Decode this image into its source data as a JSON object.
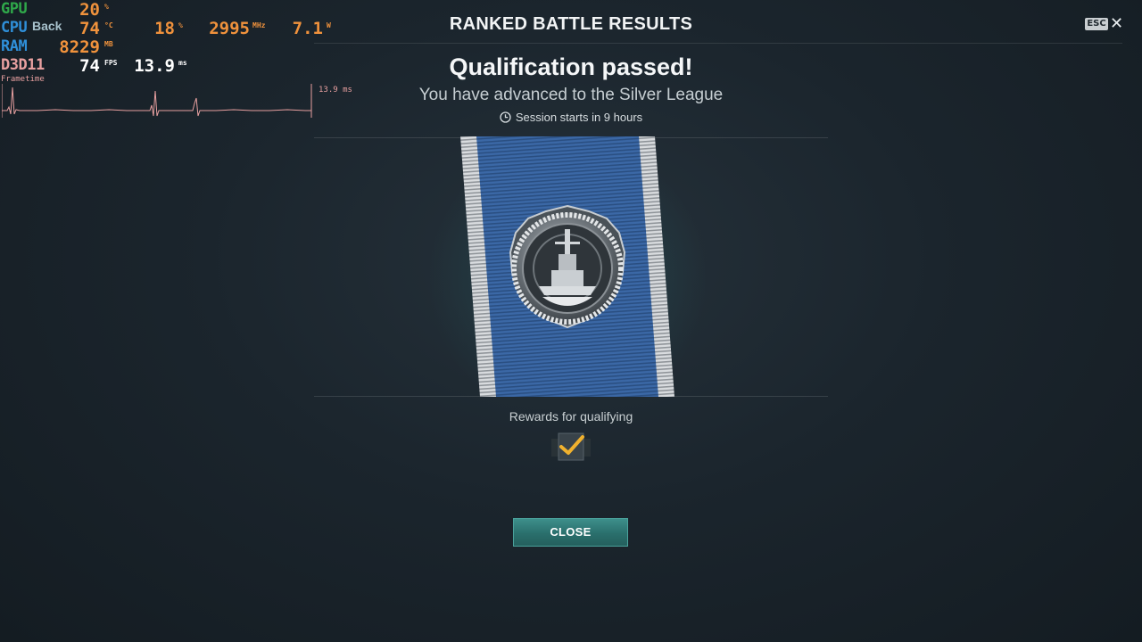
{
  "osd": {
    "rows": [
      {
        "key": "GPU",
        "value": "20",
        "unit": "%"
      },
      {
        "key": "CPU",
        "value": "74",
        "unit": "°C",
        "extra": [
          {
            "value": "18",
            "unit": "%"
          },
          {
            "value": "2995",
            "unit": "MHz"
          },
          {
            "value": "7.1",
            "unit": "W"
          }
        ]
      },
      {
        "key": "RAM",
        "value": "8229",
        "unit": "MB"
      },
      {
        "key": "D3D11",
        "value": "74",
        "unit": "FPS",
        "value2": "13.9",
        "unit2": "ms"
      }
    ],
    "frametime_label": "Frametime",
    "frametime_ms": "13.9 ms",
    "back_label": "Back"
  },
  "header": {
    "title": "RANKED BATTLE RESULTS",
    "esc_label": "ESC",
    "close_glyph": "✕"
  },
  "result": {
    "title": "Qualification passed!",
    "subtitle": "You have advanced to the Silver League",
    "session_text": "Session starts in 9 hours",
    "rewards_label": "Rewards for qualifying",
    "close_label": "CLOSE"
  },
  "icons": {
    "clock": "clock-icon",
    "medal": "silver-league-medal",
    "reward": "checkmark-reward-icon",
    "close": "close-icon"
  },
  "colors": {
    "gpu": "#2fa84a",
    "cpu": "#2f8fd8",
    "ram": "#2f8fd8",
    "d3d": "#e8a0a0",
    "values": "#f0923c",
    "accent_button": "#2a6f6c",
    "ribbon_blue": "#3c6aa8"
  }
}
